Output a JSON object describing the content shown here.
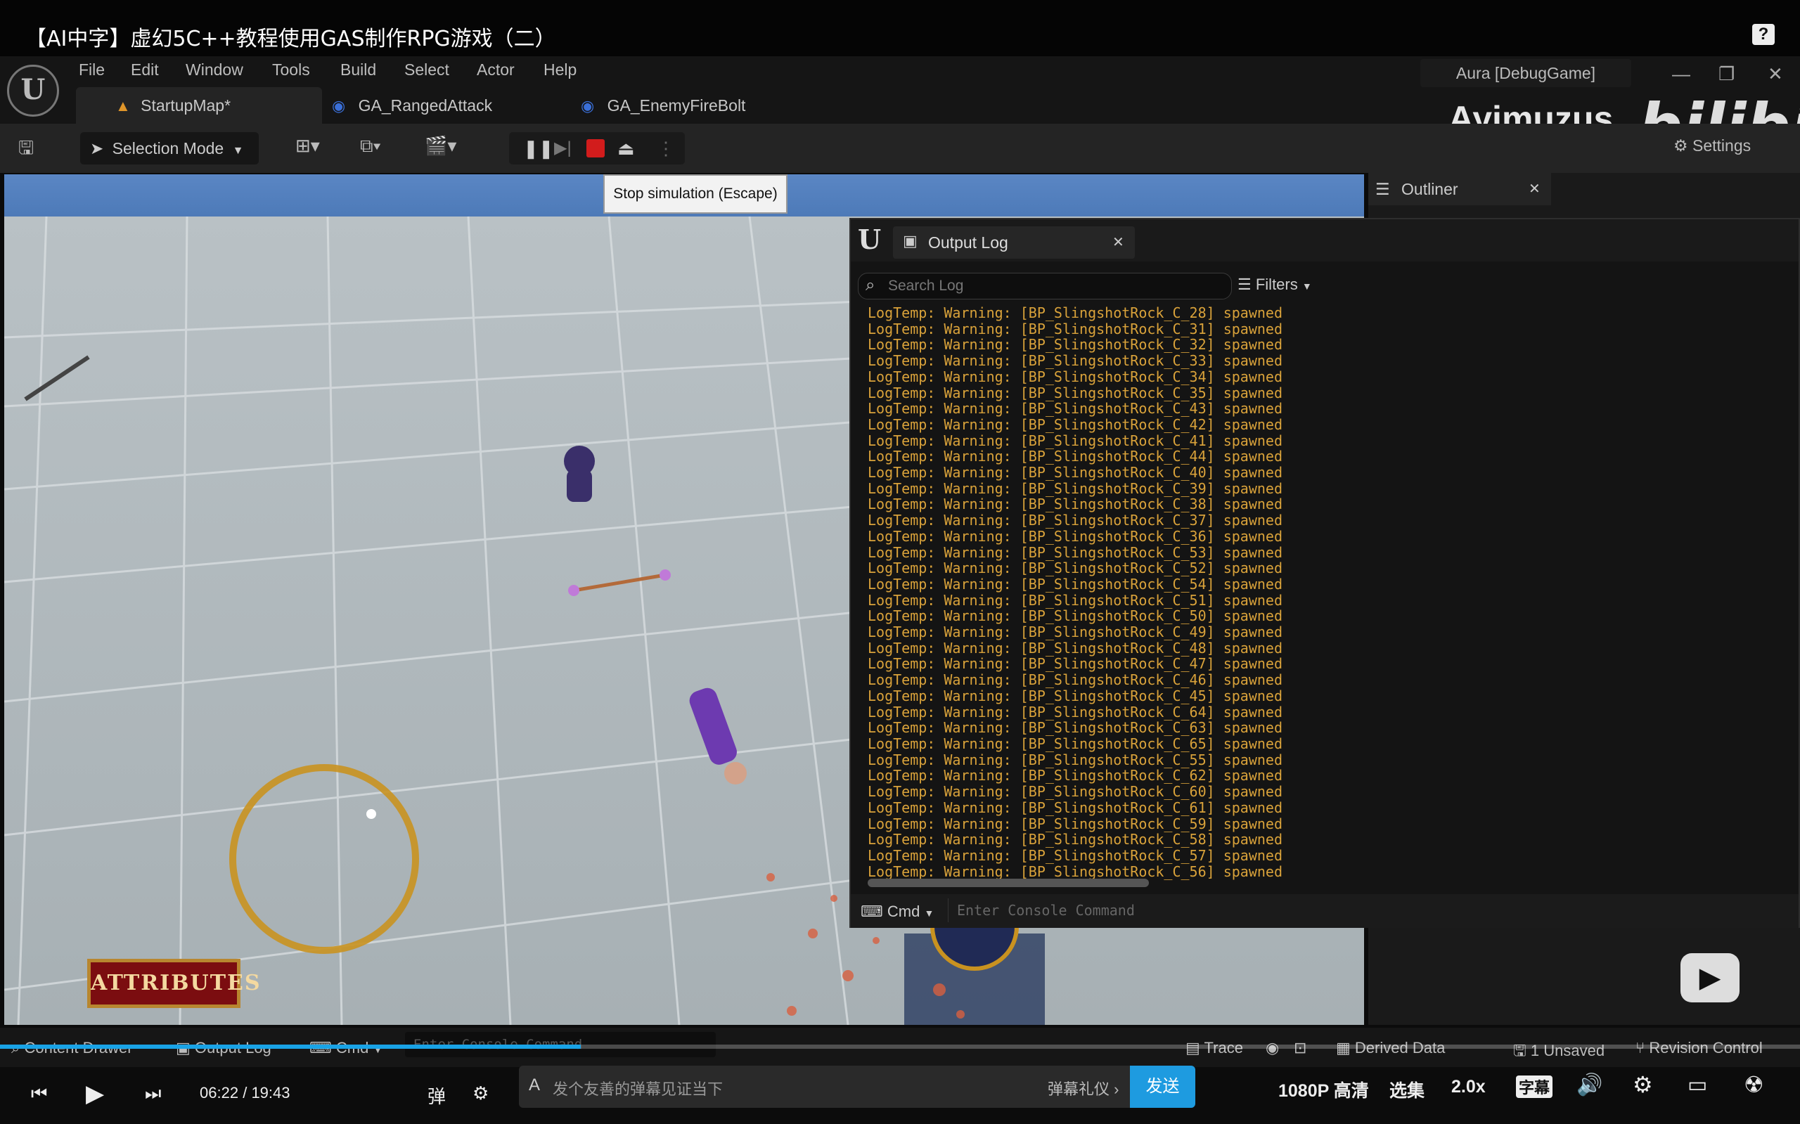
{
  "video": {
    "title": "【AI中字】虚幻5C++教程使用GAS制作RPG游戏（二）",
    "help_icon": "?",
    "time_current": "06:22",
    "time_sep": "/",
    "time_total": "19:43",
    "progress_fraction": 0.3225,
    "danmaku_placeholder": "发个友善的弹幕见证当下",
    "danmaku_etiquette": "弹幕礼仪 ›",
    "send_label": "发送",
    "quality_label": "1080P 高清",
    "episodes_label": "选集",
    "speed_label": "2.0x",
    "subtitle_label": "字幕",
    "watermark_user": "Ayimuzus",
    "watermark_brand": "bilibili"
  },
  "editor": {
    "logo": "U",
    "menu": [
      "File",
      "Edit",
      "Window",
      "Tools",
      "Build",
      "Select",
      "Actor",
      "Help"
    ],
    "tabs": [
      {
        "label": "StartupMap*"
      },
      {
        "label": "GA_RangedAttack"
      },
      {
        "label": "GA_EnemyFireBolt"
      }
    ],
    "window_title": "Aura [DebugGame]",
    "selection_mode": "Selection Mode",
    "settings_label": "Settings",
    "tooltip": "Stop simulation (Escape)",
    "outliner_label": "Outliner",
    "attributes_label": "ATTRIBUTES"
  },
  "output_log": {
    "title": "Output Log",
    "search_placeholder": "Search Log",
    "filters_label": "Filters",
    "cmd_label": "Cmd",
    "console_placeholder": "Enter Console Command",
    "lines": [
      "LogTemp: Warning: [BP_SlingshotRock_C_28] spawned",
      "LogTemp: Warning: [BP_SlingshotRock_C_31] spawned",
      "LogTemp: Warning: [BP_SlingshotRock_C_32] spawned",
      "LogTemp: Warning: [BP_SlingshotRock_C_33] spawned",
      "LogTemp: Warning: [BP_SlingshotRock_C_34] spawned",
      "LogTemp: Warning: [BP_SlingshotRock_C_35] spawned",
      "LogTemp: Warning: [BP_SlingshotRock_C_43] spawned",
      "LogTemp: Warning: [BP_SlingshotRock_C_42] spawned",
      "LogTemp: Warning: [BP_SlingshotRock_C_41] spawned",
      "LogTemp: Warning: [BP_SlingshotRock_C_44] spawned",
      "LogTemp: Warning: [BP_SlingshotRock_C_40] spawned",
      "LogTemp: Warning: [BP_SlingshotRock_C_39] spawned",
      "LogTemp: Warning: [BP_SlingshotRock_C_38] spawned",
      "LogTemp: Warning: [BP_SlingshotRock_C_37] spawned",
      "LogTemp: Warning: [BP_SlingshotRock_C_36] spawned",
      "LogTemp: Warning: [BP_SlingshotRock_C_53] spawned",
      "LogTemp: Warning: [BP_SlingshotRock_C_52] spawned",
      "LogTemp: Warning: [BP_SlingshotRock_C_54] spawned",
      "LogTemp: Warning: [BP_SlingshotRock_C_51] spawned",
      "LogTemp: Warning: [BP_SlingshotRock_C_50] spawned",
      "LogTemp: Warning: [BP_SlingshotRock_C_49] spawned",
      "LogTemp: Warning: [BP_SlingshotRock_C_48] spawned",
      "LogTemp: Warning: [BP_SlingshotRock_C_47] spawned",
      "LogTemp: Warning: [BP_SlingshotRock_C_46] spawned",
      "LogTemp: Warning: [BP_SlingshotRock_C_45] spawned",
      "LogTemp: Warning: [BP_SlingshotRock_C_64] spawned",
      "LogTemp: Warning: [BP_SlingshotRock_C_63] spawned",
      "LogTemp: Warning: [BP_SlingshotRock_C_65] spawned",
      "LogTemp: Warning: [BP_SlingshotRock_C_55] spawned",
      "LogTemp: Warning: [BP_SlingshotRock_C_62] spawned",
      "LogTemp: Warning: [BP_SlingshotRock_C_60] spawned",
      "LogTemp: Warning: [BP_SlingshotRock_C_61] spawned",
      "LogTemp: Warning: [BP_SlingshotRock_C_59] spawned",
      "LogTemp: Warning: [BP_SlingshotRock_C_58] spawned",
      "LogTemp: Warning: [BP_SlingshotRock_C_57] spawned",
      "LogTemp: Warning: [BP_SlingshotRock_C_56] spawned"
    ]
  },
  "statusbar": {
    "content_drawer": "Content Drawer",
    "output_log": "Output Log",
    "cmd": "Cmd",
    "console_placeholder": "Enter Console Command",
    "trace": "Trace",
    "derived_data": "Derived Data",
    "unsaved": "1 Unsaved",
    "revision_control": "Revision Control"
  },
  "colors": {
    "log_warning": "#d9a23a",
    "accent_blue": "#1e9be0",
    "tab_asset_icon": "#3a6fd8",
    "startupmap_icon": "#e0962a"
  }
}
